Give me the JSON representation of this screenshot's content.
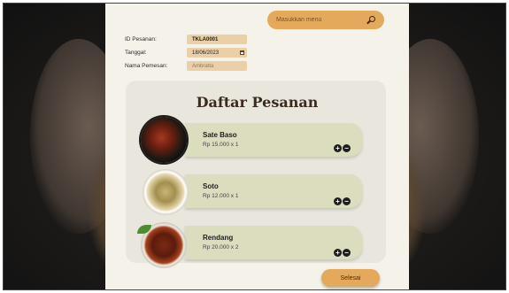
{
  "search": {
    "placeholder": "Masukkan menu"
  },
  "form": {
    "id_label": "ID Pesanan:",
    "id_value": "TKLA0001",
    "date_label": "Tanggal:",
    "date_value": "18/06/2023",
    "name_label": "Nama Pemesan:",
    "name_placeholder": "Ambratta"
  },
  "order_list": {
    "title": "Daftar Pesanan",
    "items": [
      {
        "name": "Sate Baso",
        "price_qty": "Rp 15.000 x 1",
        "image": "sate-dish"
      },
      {
        "name": "Soto",
        "price_qty": "Rp 12.000 x 1",
        "image": "soto-dish"
      },
      {
        "name": "Rendang",
        "price_qty": "Rp 20.000 x 2",
        "image": "rendang-dish"
      }
    ],
    "add_symbol": "+",
    "remove_symbol": "−"
  },
  "actions": {
    "done_label": "Selesai"
  },
  "colors": {
    "accent": "#e4a95a",
    "panel": "#f5f2e9",
    "item_card": "#dcdcbe",
    "field": "#ebcfa6"
  }
}
